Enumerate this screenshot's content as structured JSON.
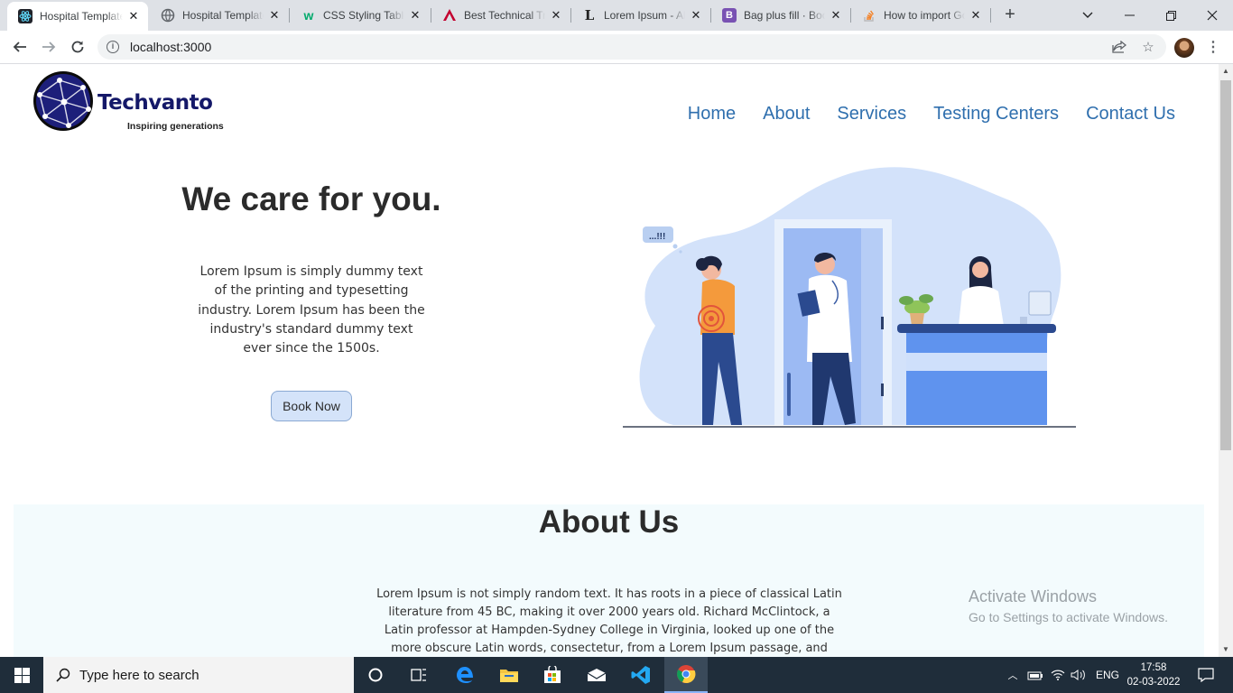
{
  "browser": {
    "tabs": [
      {
        "title": "Hospital Template",
        "favicon": "react-icon",
        "active": true
      },
      {
        "title": "Hospital Template",
        "favicon": "globe-icon",
        "active": false
      },
      {
        "title": "CSS Styling Tables",
        "favicon": "w3schools-icon",
        "active": false
      },
      {
        "title": "Best Technical Training",
        "favicon": "angular-icon",
        "active": false
      },
      {
        "title": "Lorem Ipsum - All the facts",
        "favicon": "lorem-icon",
        "active": false
      },
      {
        "title": "Bag plus fill · Bootstrap",
        "favicon": "bootstrap-icon",
        "active": false
      },
      {
        "title": "How to import Google Fonts",
        "favicon": "stackoverflow-icon",
        "active": false
      }
    ],
    "url": "localhost:3000"
  },
  "page": {
    "logo": {
      "brand": "Techvanto",
      "tagline": "Inspiring generations"
    },
    "nav": [
      "Home",
      "About",
      "Services",
      "Testing Centers",
      "Contact Us"
    ],
    "hero": {
      "title": "We care for you.",
      "text": "Lorem Ipsum is simply dummy text of the printing and typesetting industry. Lorem Ipsum has been the industry's standard dummy text ever since the 1500s.",
      "button": "Book Now",
      "speech_bubble": "...!!!"
    },
    "about": {
      "title": "About Us",
      "text": "Lorem Ipsum is not simply random text. It has roots in a piece of classical Latin literature from 45 BC, making it over 2000 years old. Richard McClintock, a Latin professor at Hampden-Sydney College in Virginia, looked up one of the more obscure Latin words, consectetur, from a Lorem Ipsum passage, and going through"
    },
    "colors": {
      "nav": "#2f6fae",
      "brand": "#141868",
      "button_bg": "#d4e3f9",
      "about_bg": "#f3fbfd"
    }
  },
  "watermark": {
    "line1": "Activate Windows",
    "line2": "Go to Settings to activate Windows."
  },
  "taskbar": {
    "search_placeholder": "Type here to search",
    "language": "ENG",
    "time": "17:58",
    "date": "02-03-2022"
  }
}
